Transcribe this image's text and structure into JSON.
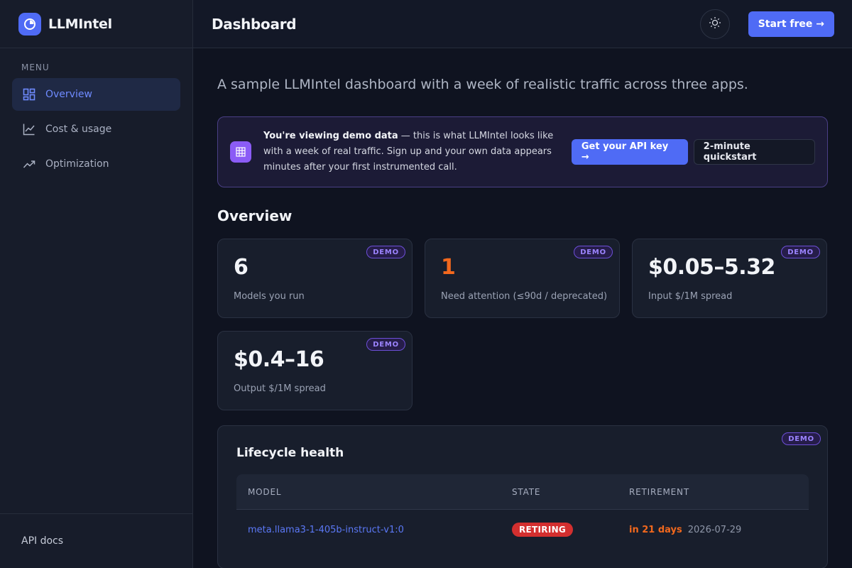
{
  "brand": {
    "name": "LLMIntel"
  },
  "sidebar": {
    "menu_label": "MENU",
    "items": [
      {
        "label": "Overview",
        "icon": "grid-icon",
        "active": true
      },
      {
        "label": "Cost & usage",
        "icon": "line-chart-icon",
        "active": false
      },
      {
        "label": "Optimization",
        "icon": "trend-up-icon",
        "active": false
      }
    ],
    "footer_link": "API docs"
  },
  "header": {
    "title": "Dashboard",
    "theme_icon": "sun-icon",
    "start_label": "Start free →"
  },
  "main": {
    "subtitle": "A sample LLMIntel dashboard with a week of realistic traffic across three apps.",
    "banner": {
      "icon": "calendar-grid-icon",
      "bold": "You're viewing demo data",
      "text": " — this is what LLMIntel looks like with a week of real traffic. Sign up and your own data appears minutes after your first instrumented call.",
      "primary_label": "Get your API key →",
      "secondary_label": "2-minute quickstart"
    },
    "overview_title": "Overview",
    "badge": "DEMO",
    "stats": [
      {
        "value": "6",
        "label": "Models you run"
      },
      {
        "value": "1",
        "label": "Need attention (≤90d / deprecated)"
      },
      {
        "value": "$0.05–5.32",
        "label": "Input $/1M spread"
      },
      {
        "value": "$0.4–16",
        "label": "Output $/1M spread"
      }
    ],
    "lifecycle": {
      "title": "Lifecycle health",
      "columns": [
        "MODEL",
        "STATE",
        "RETIREMENT"
      ],
      "rows": [
        {
          "model": "meta.llama3-1-405b-instruct-v1:0",
          "state": "RETIRING",
          "days": "in 21 days",
          "date": "2026-07-29"
        }
      ]
    }
  },
  "colors": {
    "accent": "#4f6bf5",
    "warning": "#f2681d",
    "danger": "#d32f2f",
    "demo": "#8b5cf6"
  }
}
